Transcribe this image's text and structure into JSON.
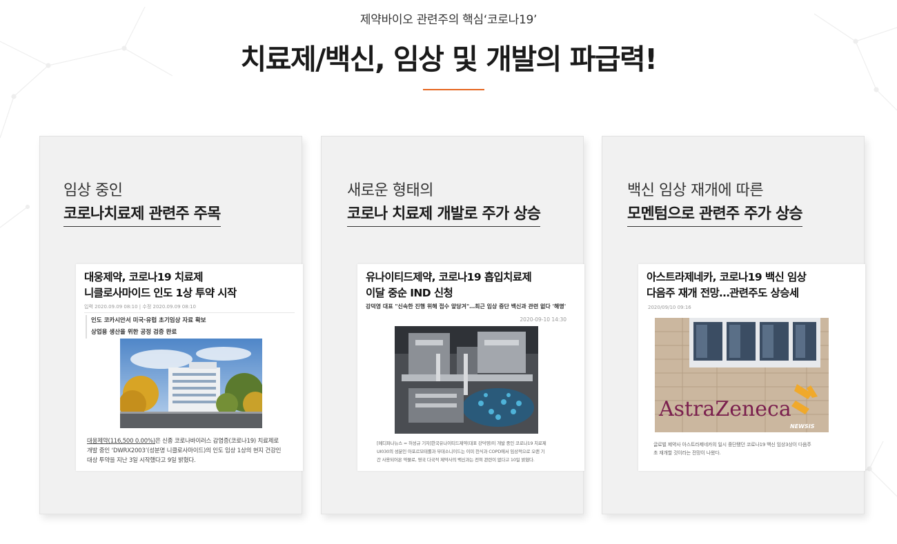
{
  "header": {
    "subtitle": "제약바이오 관련주의 핵심‘코로나19’",
    "title": "치료제/백신, 임상 및 개발의 파급력!"
  },
  "colors": {
    "accent": "#e5641d",
    "card_bg": "#f1f1f1"
  },
  "cards": [
    {
      "lead": "임상 중인",
      "head": "코로나치료제 관련주 주목",
      "news": {
        "title_line1": "대웅제약, 코로나19 치료제",
        "title_line2": "니클로사마이드 인도 1상 투약 시작",
        "meta": "입력 2020.09.09 08:10 | 수정 2020.09.09 08:10",
        "quote_line1": "인도 코카시안서 미국·유럽 초기임상 자료 확보",
        "quote_line2": "상업용 생산을 위한 공정 검증 완료",
        "photo": "building-photo",
        "body_link": "대웅제약(116,500 0.00%)",
        "body_line1_rest": "은 신종 코로나바이러스 감염증(코로나19) 치료제로",
        "body_line2": "개발 중인 ‘DWRX2003’(성분명 니클로사마이드)의 인도 임상 1상의 현지 건강인",
        "body_line3": "대상 투약을 지난 3일 시작했다고 9일 밝혔다."
      }
    },
    {
      "lead": "새로운 형태의",
      "head": "코로나 치료제 개발로 주가 상승",
      "news": {
        "title_line1": "유나이티드제약, 코로나19 흡입치료제",
        "title_line2": "이달 중순 IND 신청",
        "sub": "강덕영 대표 \"신속한 진행 위해 접수 앞당겨\"…최근 임상 중단 백신과 관련 없다 '해명'",
        "date": "2020-09-10 14:30",
        "photo": "factory-machine-photo",
        "body_line1": "[메디파나뉴스 = 허성규 기자]한국유나이티드제약(대표 강덕영)이 개발 중인 코로나19 치료제",
        "body_line2": "UI030의 성분인 아포르모테롤과 부데소니이드는 이미 천식과 COPD에서 임상적으로 오랜 기",
        "body_line3": "간 사용되어온 약물로, 영국 다국적 제약사의 백신과는 전혀 관련이 없다고 10일 밝혔다."
      }
    },
    {
      "lead": "백신 임상 재개에 따른",
      "head": "모멘텀으로 관련주 주가 상승",
      "news": {
        "title_line1": "아스트라제네카, 코로나19 백신 임상",
        "title_line2": "다음주 재개 전망…관련주도 상승세",
        "meta": "2020/09/10 09:16",
        "photo": "astrazeneca-building-photo",
        "photo_sign": "AstraZeneca",
        "photo_watermark": "NEWSIS",
        "body_line1": "글로벌 제약사 아스트라제네카의 일시 중단됐던 코로나19 백신 임상3상이 다음주",
        "body_line2": "초 재개할 것이라는 전망이 나왔다."
      }
    }
  ]
}
